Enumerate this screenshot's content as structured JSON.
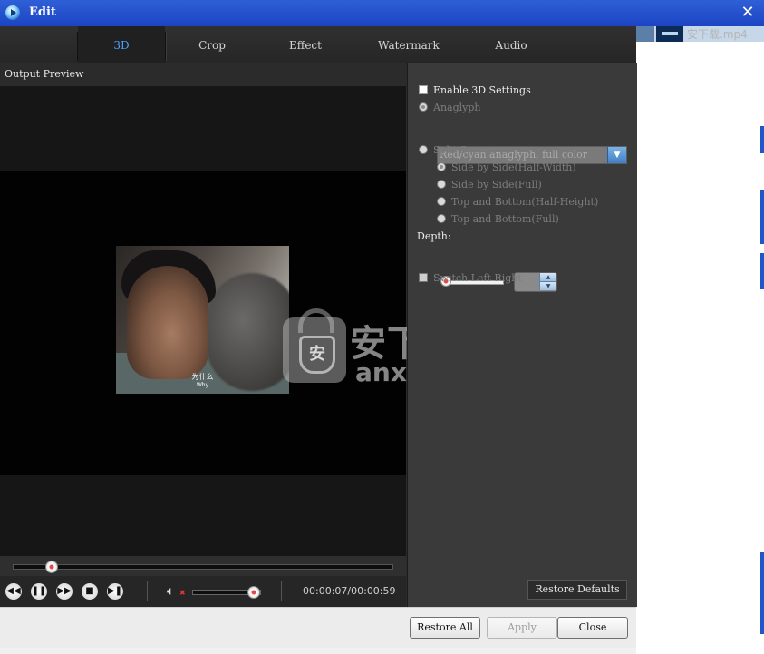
{
  "window": {
    "title": "Edit"
  },
  "tabs": [
    {
      "label": "3D",
      "active": true
    },
    {
      "label": "Crop"
    },
    {
      "label": "Effect"
    },
    {
      "label": "Watermark"
    },
    {
      "label": "Audio"
    }
  ],
  "preview": {
    "label": "Output Preview",
    "subtitle_cn": "为什么",
    "subtitle_en": "Why",
    "watermark_cn": "安下载",
    "watermark_en": "anxz.com",
    "watermark_shield": "安"
  },
  "player": {
    "progress_fraction": 0.1,
    "volume_fraction": 0.9,
    "timecode": "00:00:07/00:00:59",
    "buttons": [
      "rewind",
      "pause",
      "fast-forward",
      "stop",
      "next-frame"
    ]
  },
  "settings": {
    "enable_3d": "Enable 3D Settings",
    "anaglyph": "Anaglyph",
    "anaglyph_mode": "Red/cyan anaglyph, full color",
    "split_screen": "Split Screen",
    "split_options": [
      "Side by Side(Half-Width)",
      "Side by Side(Full)",
      "Top and Bottom(Half-Height)",
      "Top and Bottom(Full)"
    ],
    "depth_label": "Depth:",
    "switch_lr": "Switch Left Right",
    "restore_defaults": "Restore Defaults"
  },
  "footer": {
    "restore_all": "Restore All",
    "apply": "Apply",
    "close": "Close"
  },
  "background_app": {
    "file_name": "安下载.mp4"
  },
  "colors": {
    "titlebar": "#2f5fd6",
    "active_tab": "#4aa3ff",
    "panel": "#3a3a3a",
    "accent_knob": "#e24a4a"
  }
}
